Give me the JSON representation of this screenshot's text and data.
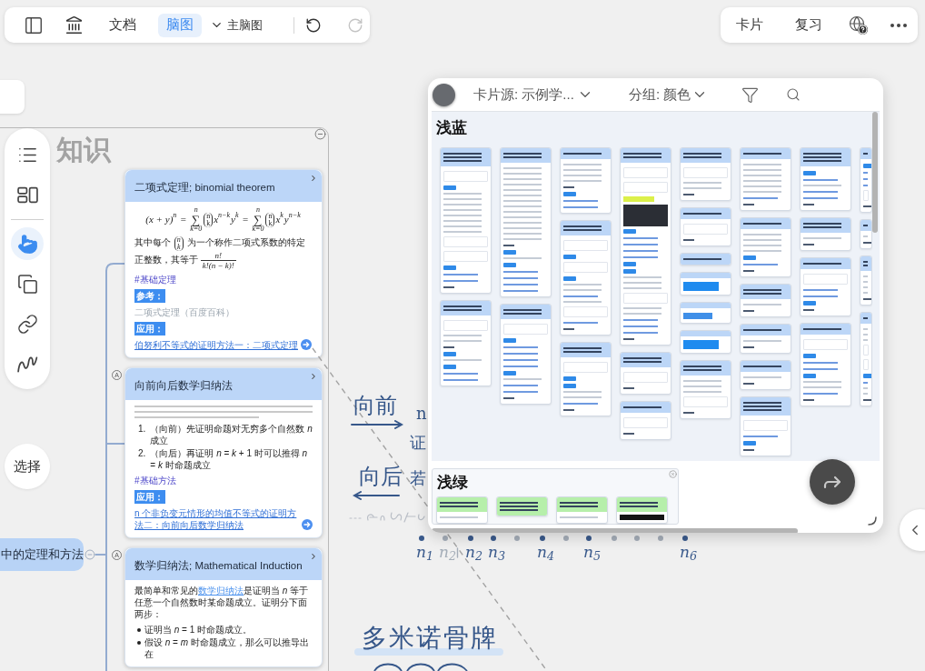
{
  "toolbar": {
    "views": [
      {
        "label": "文档",
        "selected": false
      },
      {
        "label": "脑图",
        "selected": true
      }
    ],
    "map_picker": {
      "label": "主脑图"
    },
    "undo": {
      "disabled": false
    },
    "redo": {
      "disabled": true
    }
  },
  "top_right_toolbar": {
    "buttons": [
      {
        "label": "卡片"
      },
      {
        "label": "复习"
      }
    ]
  },
  "tool_palette": {
    "view_tools": [
      {
        "kind": "outline",
        "selected": false
      },
      {
        "kind": "layout",
        "selected": false
      }
    ],
    "tools": [
      {
        "kind": "hand",
        "selected": true
      },
      {
        "kind": "copy",
        "selected": false
      },
      {
        "kind": "link",
        "selected": false
      },
      {
        "kind": "pen",
        "selected": false
      }
    ]
  },
  "select_button": {
    "label": "选择"
  },
  "canvas": {
    "title": "知识",
    "frame": {
      "expanded": true
    },
    "root_node": {
      "label": "中的定理和方法",
      "expanded": true
    },
    "cards": [
      {
        "title": "二项式定理; binomial theorem",
        "blocks": [
          {
            "kind": "formula",
            "terms": [
              {
                "kind": "text",
                "text": "(x + y)"
              },
              {
                "kind": "sup",
                "text": "n"
              },
              {
                "kind": "text",
                "text": " = "
              },
              {
                "kind": "sum",
                "symbol": "∑",
                "over": "n",
                "under": "k=0"
              },
              {
                "kind": "binom",
                "top": "n",
                "bottom": "k"
              },
              {
                "kind": "text",
                "text": "x"
              },
              {
                "kind": "sup",
                "text": "n−k"
              },
              {
                "kind": "text",
                "text": "y"
              },
              {
                "kind": "sup",
                "text": "k"
              },
              {
                "kind": "text",
                "text": " = "
              },
              {
                "kind": "sum",
                "symbol": "∑",
                "over": "n",
                "under": "k=0"
              },
              {
                "kind": "binom",
                "top": "n",
                "bottom": "k"
              },
              {
                "kind": "text",
                "text": "x"
              },
              {
                "kind": "sup",
                "text": "k"
              },
              {
                "kind": "text",
                "text": "y"
              },
              {
                "kind": "sup",
                "text": "n−k"
              }
            ]
          },
          {
            "kind": "paragraph",
            "parts": [
              {
                "kind": "text",
                "text": "其中每个 "
              },
              {
                "kind": "binom",
                "top": "n",
                "bottom": "k"
              },
              {
                "kind": "text",
                "text": " 为一个称作二项式系数的特定正整数，其等于 "
              },
              {
                "kind": "fraction",
                "top": "n!",
                "bottom": "k!(n − k)!"
              }
            ]
          },
          {
            "kind": "tag",
            "text": "#基础定理"
          },
          {
            "kind": "label",
            "text": "参考："
          },
          {
            "kind": "source",
            "text": "二项式定理（百度百科）"
          },
          {
            "kind": "label",
            "text": "应用："
          },
          {
            "kind": "link",
            "text": "伯努利不等式的证明方法一：二项式定理"
          }
        ]
      },
      {
        "title": "向前向后数学归纳法",
        "marker": "A",
        "blocks": [
          {
            "kind": "note"
          },
          {
            "kind": "ordered_list",
            "items": [
              {
                "number": "1.",
                "text": "（向前）先证明命题对无穷多个自然数 *n* 成立"
              },
              {
                "number": "2.",
                "text": "（向后）再证明 *n* = *k* + 1 时可以推得 *n* = *k* 时命题成立"
              }
            ]
          },
          {
            "kind": "tag",
            "text": "#基础方法"
          },
          {
            "kind": "label",
            "text": "应用："
          },
          {
            "kind": "link",
            "text": "n 个非负变元情形的均值不等式的证明方法二：向前向后数学归纳法"
          }
        ]
      },
      {
        "title": "数学归纳法; Mathematical Induction",
        "marker": "A",
        "blocks": [
          {
            "kind": "paragraph",
            "parts": [
              {
                "kind": "text",
                "text": "最简单和常见的"
              },
              {
                "kind": "link",
                "text": "数学归纳法"
              },
              {
                "kind": "text",
                "text": "是证明当 *n* 等于任意一个自然数时某命题成立。证明分下面两步："
              }
            ]
          },
          {
            "kind": "bullet_list",
            "items": [
              "证明当 *n* = 1 时命题成立。",
              "假设 *n* = *m* 时命题成立，那么可以推导出在"
            ]
          }
        ]
      }
    ],
    "handwriting": {
      "forward": {
        "text": "向前"
      },
      "backward": {
        "text": "向后"
      },
      "fragments": [
        {
          "text": "n"
        },
        {
          "text": "证"
        },
        {
          "text": "若"
        }
      ],
      "points": [
        {
          "color": "#3a5a8c",
          "label": "n$_{1}$"
        },
        {
          "color": "#a4adb8",
          "label": "n$_{2}$"
        },
        {
          "color": "#3a5a8c",
          "label": "n$_{2}$"
        },
        {
          "color": "#3a5a8c",
          "label": "n$_{3}$"
        },
        {
          "color": "#a4adb8"
        },
        {
          "color": "#3a5a8c",
          "label": "n$_{4}$"
        },
        {
          "color": "#a4adb8"
        },
        {
          "color": "#3a5a8c",
          "label": "n$_{5}$"
        },
        {
          "color": "#a4adb8"
        },
        {
          "color": "#a4adb8"
        },
        {
          "color": "#a4adb8"
        },
        {
          "color": "#3a5a8c",
          "label": "n$_{6}$"
        }
      ],
      "caption": "多米诺骨牌"
    }
  },
  "card_panel": {
    "source": "卡片源: 示例学...",
    "grouping": "分组: 颜色",
    "groups": [
      {
        "name": "浅蓝",
        "kind": "open",
        "color": "#bcd6f7",
        "columns": [
          [
            {
              "head": [
                {
                  "kind": "line"
                },
                {
                  "kind": "line"
                },
                {
                  "kind": "line"
                }
              ],
              "rows": [
                {
                  "kind": "formula"
                },
                {
                  "kind": "label"
                },
                {
                  "kind": "text"
                },
                {
                  "kind": "text"
                },
                {
                  "kind": "text"
                },
                {
                  "kind": "text"
                },
                {
                  "kind": "text"
                },
                {
                  "kind": "text"
                },
                {
                  "kind": "text"
                },
                {
                  "kind": "text"
                },
                {
                  "kind": "formula"
                },
                {
                  "kind": "formula"
                },
                {
                  "kind": "label"
                },
                {
                  "kind": "link"
                },
                {
                  "kind": "link"
                },
                {
                  "kind": "tag"
                }
              ]
            },
            {
              "head": [
                {
                  "kind": "line"
                },
                {
                  "kind": "line"
                }
              ],
              "rows": [
                {
                  "kind": "formula"
                },
                {
                  "kind": "text"
                },
                {
                  "kind": "text"
                },
                {
                  "kind": "tag"
                },
                {
                  "kind": "label"
                },
                {
                  "kind": "text"
                },
                {
                  "kind": "label"
                },
                {
                  "kind": "link"
                },
                {
                  "kind": "link"
                }
              ]
            }
          ],
          [
            {
              "head": [
                {
                  "kind": "line"
                },
                {
                  "kind": "line"
                }
              ],
              "rows": [
                {
                  "kind": "text"
                },
                {
                  "kind": "text"
                },
                {
                  "kind": "text"
                },
                {
                  "kind": "text"
                },
                {
                  "kind": "text"
                },
                {
                  "kind": "text"
                },
                {
                  "kind": "text"
                },
                {
                  "kind": "text"
                },
                {
                  "kind": "text"
                },
                {
                  "kind": "text"
                },
                {
                  "kind": "text"
                },
                {
                  "kind": "text"
                },
                {
                  "kind": "text"
                },
                {
                  "kind": "text"
                },
                {
                  "kind": "tag"
                },
                {
                  "kind": "label"
                },
                {
                  "kind": "text"
                },
                {
                  "kind": "label"
                },
                {
                  "kind": "link"
                },
                {
                  "kind": "link"
                },
                {
                  "kind": "link"
                },
                {
                  "kind": "link"
                }
              ]
            },
            {
              "head": [
                {
                  "kind": "line"
                },
                {
                  "kind": "line"
                }
              ],
              "rows": [
                {
                  "kind": "formula"
                },
                {
                  "kind": "label"
                },
                {
                  "kind": "link"
                },
                {
                  "kind": "link"
                },
                {
                  "kind": "link"
                },
                {
                  "kind": "link"
                },
                {
                  "kind": "label"
                },
                {
                  "kind": "text"
                },
                {
                  "kind": "link"
                },
                {
                  "kind": "link"
                },
                {
                  "kind": "tag"
                }
              ]
            }
          ],
          [
            {
              "head": [
                {
                  "kind": "line"
                }
              ],
              "rows": [
                {
                  "kind": "text"
                },
                {
                  "kind": "text"
                },
                {
                  "kind": "text"
                },
                {
                  "kind": "text"
                },
                {
                  "kind": "tag"
                },
                {
                  "kind": "label"
                },
                {
                  "kind": "link"
                },
                {
                  "kind": "link"
                }
              ]
            },
            {
              "head": [
                {
                  "kind": "line"
                },
                {
                  "kind": "line"
                }
              ],
              "rows": [
                {
                  "kind": "formula"
                },
                {
                  "kind": "label"
                },
                {
                  "kind": "formula"
                },
                {
                  "kind": "label"
                },
                {
                  "kind": "text"
                },
                {
                  "kind": "text"
                },
                {
                  "kind": "link"
                },
                {
                  "kind": "text"
                },
                {
                  "kind": "formula"
                },
                {
                  "kind": "link"
                },
                {
                  "kind": "tag"
                }
              ]
            },
            {
              "head": [
                {
                  "kind": "line"
                },
                {
                  "kind": "line"
                }
              ],
              "rows": [
                {
                  "kind": "formula"
                },
                {
                  "kind": "label"
                },
                {
                  "kind": "label"
                },
                {
                  "kind": "text"
                },
                {
                  "kind": "text"
                },
                {
                  "kind": "link"
                },
                {
                  "kind": "tag"
                }
              ]
            }
          ],
          [
            {
              "head": [
                {
                  "kind": "line"
                },
                {
                  "kind": "line"
                }
              ],
              "rows": [
                {
                  "kind": "formula"
                },
                {
                  "kind": "formula"
                },
                {
                  "kind": "highlight"
                },
                {
                  "kind": "image"
                },
                {
                  "kind": "label"
                },
                {
                  "kind": "link"
                },
                {
                  "kind": "link"
                },
                {
                  "kind": "link"
                },
                {
                  "kind": "link"
                },
                {
                  "kind": "label"
                },
                {
                  "kind": "label"
                },
                {
                  "kind": "text"
                },
                {
                  "kind": "text"
                },
                {
                  "kind": "text"
                },
                {
                  "kind": "formula"
                },
                {
                  "kind": "text"
                },
                {
                  "kind": "text"
                },
                {
                  "kind": "link"
                },
                {
                  "kind": "link"
                },
                {
                  "kind": "link"
                },
                {
                  "kind": "tag"
                }
              ]
            },
            {
              "head": [
                {
                  "kind": "line"
                },
                {
                  "kind": "line"
                }
              ],
              "rows": [
                {
                  "kind": "formula"
                },
                {
                  "kind": "tag"
                }
              ]
            },
            {
              "head": [
                {
                  "kind": "line"
                }
              ],
              "rows": [
                {
                  "kind": "formula"
                },
                {
                  "kind": "tag"
                }
              ]
            }
          ],
          [
            {
              "head": [
                {
                  "kind": "line"
                },
                {
                  "kind": "line"
                }
              ],
              "rows": [
                {
                  "kind": "formula"
                },
                {
                  "kind": "text"
                },
                {
                  "kind": "text"
                },
                {
                  "kind": "tag"
                }
              ]
            },
            {
              "head": [
                {
                  "kind": "line"
                }
              ],
              "rows": [
                {
                  "kind": "formula"
                },
                {
                  "kind": "tag"
                }
              ]
            },
            {
              "head": [
                {
                  "kind": "line"
                }
              ]
            },
            {
              "rows": [
                {
                  "kind": "bar"
                }
              ]
            },
            {
              "rows": [
                {
                  "kind": "selection"
                }
              ]
            },
            {
              "rows": [
                {
                  "kind": "bar"
                }
              ]
            },
            {
              "head": [
                {
                  "kind": "line"
                },
                {
                  "kind": "line"
                }
              ],
              "rows": [
                {
                  "kind": "text"
                },
                {
                  "kind": "text"
                },
                {
                  "kind": "text"
                },
                {
                  "kind": "formula"
                },
                {
                  "kind": "tag"
                }
              ]
            }
          ],
          [
            {
              "head": [
                {
                  "kind": "line"
                }
              ],
              "rows": [
                {
                  "kind": "text"
                },
                {
                  "kind": "text"
                },
                {
                  "kind": "text"
                },
                {
                  "kind": "text"
                },
                {
                  "kind": "text"
                },
                {
                  "kind": "text"
                },
                {
                  "kind": "link"
                },
                {
                  "kind": "tag"
                }
              ]
            },
            {
              "head": [
                {
                  "kind": "line"
                }
              ],
              "rows": [
                {
                  "kind": "text"
                },
                {
                  "kind": "text"
                },
                {
                  "kind": "text"
                },
                {
                  "kind": "text"
                },
                {
                  "kind": "label"
                },
                {
                  "kind": "link"
                },
                {
                  "kind": "tag"
                }
              ]
            },
            {
              "head": [
                {
                  "kind": "line"
                },
                {
                  "kind": "line"
                }
              ],
              "rows": [
                {
                  "kind": "text"
                },
                {
                  "kind": "tag"
                }
              ]
            },
            {
              "head": [
                {
                  "kind": "line"
                }
              ],
              "rows": [
                {
                  "kind": "text"
                },
                {
                  "kind": "tag"
                }
              ]
            },
            {
              "head": [
                {
                  "kind": "line"
                }
              ],
              "rows": [
                {
                  "kind": "text"
                },
                {
                  "kind": "tag"
                }
              ]
            },
            {
              "head": [
                {
                  "kind": "line"
                },
                {
                  "kind": "line"
                },
                {
                  "kind": "line"
                }
              ],
              "rows": [
                {
                  "kind": "formula"
                },
                {
                  "kind": "link"
                },
                {
                  "kind": "label"
                },
                {
                  "kind": "tag"
                }
              ]
            }
          ],
          [
            {
              "head": [
                {
                  "kind": "line"
                },
                {
                  "kind": "line"
                },
                {
                  "kind": "line"
                }
              ],
              "rows": [
                {
                  "kind": "label"
                },
                {
                  "kind": "link"
                },
                {
                  "kind": "text"
                },
                {
                  "kind": "link"
                },
                {
                  "kind": "link"
                },
                {
                  "kind": "tag"
                }
              ]
            },
            {
              "head": [
                {
                  "kind": "line"
                },
                {
                  "kind": "line"
                }
              ],
              "rows": [
                {
                  "kind": "text"
                },
                {
                  "kind": "tag"
                }
              ]
            },
            {
              "head": [
                {
                  "kind": "line"
                }
              ],
              "rows": [
                {
                  "kind": "formula"
                },
                {
                  "kind": "link"
                },
                {
                  "kind": "link"
                },
                {
                  "kind": "label"
                },
                {
                  "kind": "tag"
                }
              ]
            },
            {
              "head": [
                {
                  "kind": "line"
                }
              ],
              "rows": [
                {
                  "kind": "formula"
                },
                {
                  "kind": "label"
                },
                {
                  "kind": "link"
                },
                {
                  "kind": "link"
                },
                {
                  "kind": "label"
                },
                {
                  "kind": "text"
                },
                {
                  "kind": "text"
                },
                {
                  "kind": "link"
                },
                {
                  "kind": "tag"
                }
              ]
            }
          ],
          [
            {
              "head": [
                {
                  "kind": "line"
                }
              ],
              "rows": [
                {
                  "kind": "label"
                },
                {
                  "kind": "link"
                },
                {
                  "kind": "link"
                },
                {
                  "kind": "link"
                },
                {
                  "kind": "formula"
                },
                {
                  "kind": "tag"
                }
              ]
            },
            {
              "head": [
                {
                  "kind": "line"
                }
              ],
              "rows": [
                {
                  "kind": "text"
                },
                {
                  "kind": "tag"
                }
              ]
            },
            {
              "head": [
                {
                  "kind": "line"
                },
                {
                  "kind": "line"
                }
              ],
              "rows": [
                {
                  "kind": "text"
                },
                {
                  "kind": "text"
                },
                {
                  "kind": "text"
                },
                {
                  "kind": "text"
                },
                {
                  "kind": "tag"
                }
              ]
            },
            {
              "head": [
                {
                  "kind": "line"
                }
              ],
              "rows": [
                {
                  "kind": "text"
                },
                {
                  "kind": "text"
                },
                {
                  "kind": "text"
                },
                {
                  "kind": "formula"
                },
                {
                  "kind": "formula"
                },
                {
                  "kind": "label"
                },
                {
                  "kind": "link"
                },
                {
                  "kind": "text"
                },
                {
                  "kind": "text"
                },
                {
                  "kind": "tag"
                }
              ]
            }
          ]
        ]
      },
      {
        "name": "浅绿",
        "kind": "framed",
        "color": "#b6efaa",
        "columns": [
          [
            {
              "head": [
                {
                  "kind": "line"
                },
                {
                  "kind": "line"
                }
              ],
              "rows": [
                {
                  "kind": "text"
                }
              ]
            }
          ],
          [
            {
              "head": [
                {
                  "kind": "line"
                },
                {
                  "kind": "line"
                },
                {
                  "kind": "line"
                }
              ]
            }
          ],
          [
            {
              "head": [
                {
                  "kind": "line"
                },
                {
                  "kind": "line"
                }
              ],
              "rows": [
                {
                  "kind": "text"
                }
              ]
            }
          ],
          [
            {
              "head": [
                {
                  "kind": "line"
                },
                {
                  "kind": "line"
                }
              ],
              "rows": [
                {
                  "kind": "caption"
                }
              ]
            }
          ]
        ]
      }
    ]
  }
}
